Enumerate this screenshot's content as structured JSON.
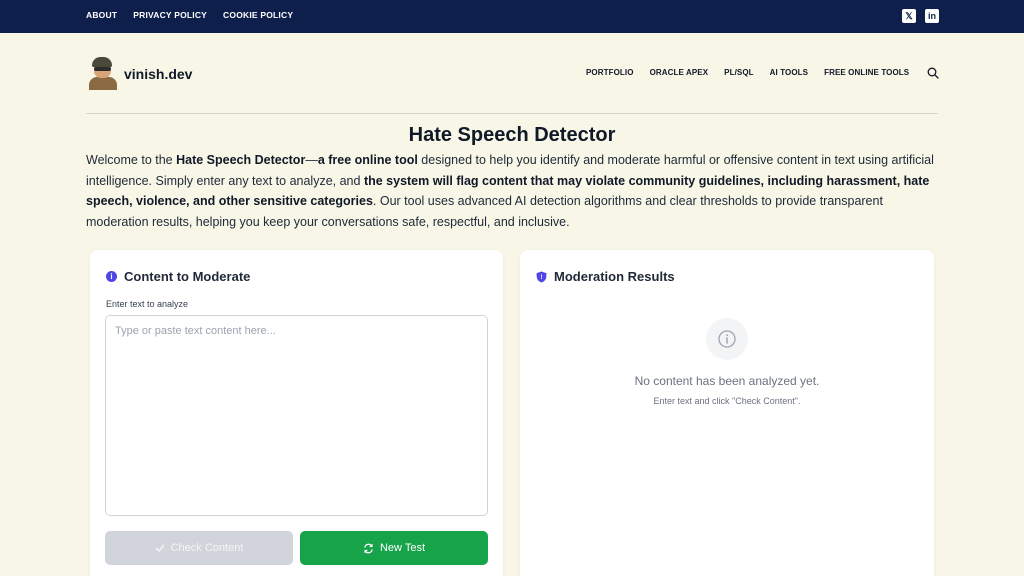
{
  "topbar": {
    "links": [
      "ABOUT",
      "PRIVACY POLICY",
      "COOKIE POLICY"
    ],
    "social": [
      {
        "icon": "x-twitter-icon",
        "glyph": "𝕏"
      },
      {
        "icon": "linkedin-icon",
        "glyph": "in"
      }
    ]
  },
  "header": {
    "brand": "vinish.dev",
    "nav": [
      "PORTFOLIO",
      "ORACLE APEX",
      "PL/SQL",
      "AI TOOLS",
      "FREE ONLINE TOOLS"
    ]
  },
  "page": {
    "title": "Hate Speech Detector",
    "intro": {
      "p1": "Welcome to the ",
      "b1": "Hate Speech Detector",
      "p2": "—",
      "b2": "a free online tool",
      "p3": " designed to help you identify and moderate harmful or offensive content in text using artificial intelligence. Simply enter any text to analyze, and ",
      "b3": "the system will flag content that may violate community guidelines, including harassment, hate speech, violence, and other sensitive categories",
      "p4": ". Our tool uses advanced AI detection algorithms and clear thresholds to provide transparent moderation results, helping you keep your conversations safe, respectful, and inclusive."
    }
  },
  "input_card": {
    "title": "Content to Moderate",
    "label": "Enter text to analyze",
    "value": "",
    "placeholder": "Type or paste text content here...",
    "check_label": "Check Content",
    "new_label": "New Test"
  },
  "results_card": {
    "title": "Moderation Results",
    "empty_title": "No content has been analyzed yet.",
    "empty_sub": "Enter text and click \"Check Content\"."
  },
  "colors": {
    "topbar": "#0f1f4b",
    "background": "#f7f6e7",
    "accent": "#4f46e5",
    "success": "#16a34a",
    "disabled": "#d1d5db"
  }
}
